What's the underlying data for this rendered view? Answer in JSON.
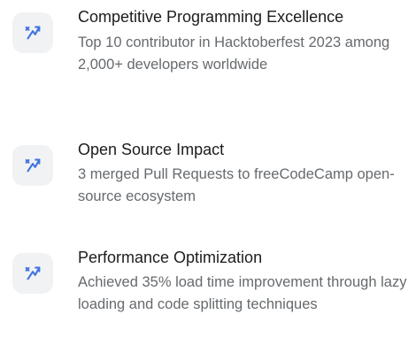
{
  "accent_color": "#3f74e0",
  "tile_color": "#f1f2f4",
  "items": [
    {
      "icon": "sparkle-arrow-icon",
      "title": "Competitive Programming Excellence",
      "description": "Top 10 contributor in Hacktoberfest 2023 among 2,000+ developers worldwide"
    },
    {
      "icon": "sparkle-arrow-icon",
      "title": "Open Source Impact",
      "description": "3 merged Pull Requests to freeCodeCamp open-source ecosystem"
    },
    {
      "icon": "sparkle-arrow-icon",
      "title": "Performance Optimization",
      "description": "Achieved 35% load time improvement through lazy loading and code splitting techniques"
    }
  ]
}
